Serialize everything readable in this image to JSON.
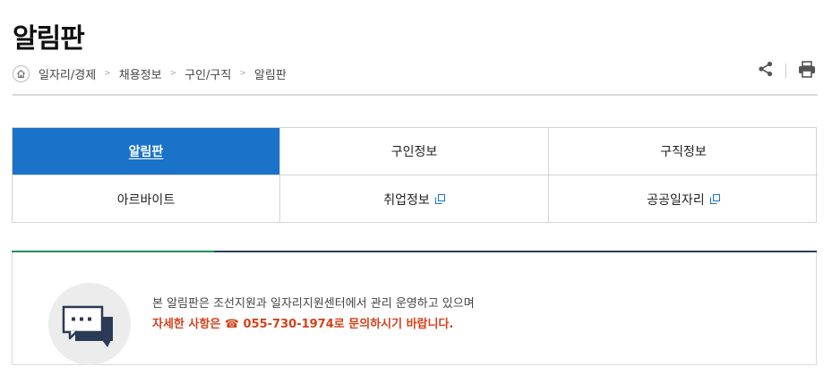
{
  "page": {
    "title": "알림판"
  },
  "breadcrumb": {
    "home_icon": "home-icon",
    "items": [
      "일자리/경제",
      "채용정보",
      "구인/구직",
      "알림판"
    ],
    "separator": ">"
  },
  "tools": {
    "share_icon": "share-icon",
    "print_icon": "print-icon"
  },
  "tabs": [
    {
      "label": "알림판",
      "active": true,
      "external": false
    },
    {
      "label": "구인정보",
      "active": false,
      "external": false
    },
    {
      "label": "구직정보",
      "active": false,
      "external": false
    },
    {
      "label": "아르바이트",
      "active": false,
      "external": false
    },
    {
      "label": "취업정보",
      "active": false,
      "external": true
    },
    {
      "label": "공공일자리",
      "active": false,
      "external": true
    }
  ],
  "notice": {
    "icon": "speech-bubble-icon",
    "line1": "본 알림판은 조선지원과 일자리지원센터에서 관리 운영하고 있으며",
    "line2": "자세한 사항은 ☎ 055-730-1974로 문의하시기 바랍니다."
  },
  "colors": {
    "active_tab": "#1a73c9",
    "notice_highlight": "#d6401a",
    "notice_bar_accent": "#1f8f5c",
    "notice_bar": "#2a3f60"
  }
}
